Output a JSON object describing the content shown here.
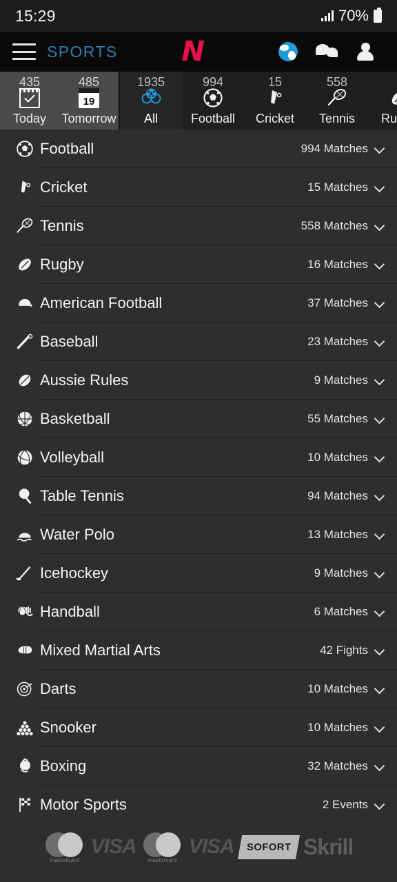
{
  "status_bar": {
    "time": "15:29",
    "battery_percent": "70%",
    "signal_icon": "signal-bars-icon",
    "battery_icon": "battery-icon"
  },
  "app_bar": {
    "menu_icon": "hamburger-menu-icon",
    "brand": "SPORTS",
    "logo": "N",
    "icons": [
      {
        "name": "globe-icon",
        "label": "Language"
      },
      {
        "name": "chat-icon",
        "label": "Chat"
      },
      {
        "name": "account-icon",
        "label": "Account"
      }
    ]
  },
  "tabs": {
    "day_tabs": [
      {
        "label": "Today",
        "count": "435",
        "icon": "calendar-check-icon",
        "selected": false
      },
      {
        "label": "Tomorrow",
        "count": "485",
        "icon": "calendar-19-icon",
        "selected": false
      }
    ],
    "sport_tabs": [
      {
        "label": "All",
        "count": "1935",
        "icon": "all-sports-icon",
        "selected": true
      },
      {
        "label": "Football",
        "count": "994",
        "icon": "football-icon",
        "selected": false
      },
      {
        "label": "Cricket",
        "count": "15",
        "icon": "cricket-icon",
        "selected": false
      },
      {
        "label": "Tennis",
        "count": "558",
        "icon": "tennis-icon",
        "selected": false
      },
      {
        "label": "Rugby",
        "count": "",
        "icon": "rugby-icon",
        "selected": false
      }
    ]
  },
  "sports_list": [
    {
      "name": "Football",
      "count": "994 Matches",
      "icon": "football-icon"
    },
    {
      "name": "Cricket",
      "count": "15 Matches",
      "icon": "cricket-icon"
    },
    {
      "name": "Tennis",
      "count": "558 Matches",
      "icon": "tennis-icon"
    },
    {
      "name": "Rugby",
      "count": "16 Matches",
      "icon": "rugby-icon"
    },
    {
      "name": "American Football",
      "count": "37 Matches",
      "icon": "american-football-icon"
    },
    {
      "name": "Baseball",
      "count": "23 Matches",
      "icon": "baseball-icon"
    },
    {
      "name": "Aussie Rules",
      "count": "9 Matches",
      "icon": "aussie-rules-icon"
    },
    {
      "name": "Basketball",
      "count": "55 Matches",
      "icon": "basketball-icon"
    },
    {
      "name": "Volleyball",
      "count": "10 Matches",
      "icon": "volleyball-icon"
    },
    {
      "name": "Table Tennis",
      "count": "94 Matches",
      "icon": "table-tennis-icon"
    },
    {
      "name": "Water Polo",
      "count": "13 Matches",
      "icon": "water-polo-icon"
    },
    {
      "name": "Icehockey",
      "count": "9 Matches",
      "icon": "icehockey-icon"
    },
    {
      "name": "Handball",
      "count": "6 Matches",
      "icon": "handball-icon"
    },
    {
      "name": "Mixed Martial Arts",
      "count": "42 Fights",
      "icon": "mma-icon"
    },
    {
      "name": "Darts",
      "count": "10 Matches",
      "icon": "darts-icon"
    },
    {
      "name": "Snooker",
      "count": "10 Matches",
      "icon": "snooker-icon"
    },
    {
      "name": "Boxing",
      "count": "32 Matches",
      "icon": "boxing-icon"
    },
    {
      "name": "Motor Sports",
      "count": "2 Events",
      "icon": "motorsports-icon"
    }
  ],
  "footer": {
    "payment_methods": [
      {
        "name": "mastercard",
        "label": "mastercard"
      },
      {
        "name": "visa",
        "label": "VISA"
      },
      {
        "name": "mastercard",
        "label": "mastercard"
      },
      {
        "name": "visa",
        "label": "VISA"
      },
      {
        "name": "sofort",
        "label": "SOFORT"
      },
      {
        "name": "skrill",
        "label": "Skrill"
      }
    ]
  },
  "colors": {
    "background": "#2e2e2e",
    "app_bar": "#090909",
    "brand_blue": "#2f7fb0",
    "logo_red": "#e8124a",
    "accent_blue": "#1e9bd7",
    "day_tabs_bg": "#4a4a4a",
    "sport_tabs_bg": "#1f1f1f",
    "selected_tab_bg": "#262626"
  }
}
